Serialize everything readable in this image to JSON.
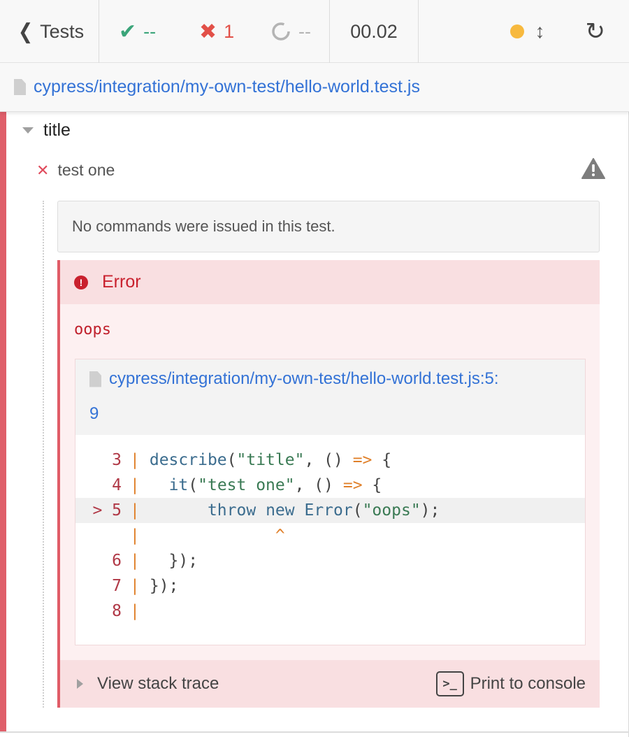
{
  "header": {
    "tests_label": "Tests",
    "passed": "--",
    "failed": "1",
    "pending": "--",
    "duration": "00.02",
    "status_dot_color": "#f7b93e"
  },
  "spec": {
    "path": "cypress/integration/my-own-test/hello-world.test.js"
  },
  "suite": {
    "title": "title"
  },
  "test": {
    "title": "test one",
    "no_commands": "No commands were issued in this test."
  },
  "error": {
    "name": "Error",
    "message": "oops",
    "file_line1": "cypress/integration/my-own-test/hello-world.test.js:5:",
    "file_line2": "9",
    "code": [
      {
        "num": "3",
        "marker": "",
        "tokens": [
          [
            "fn",
            "describe"
          ],
          [
            "p",
            "("
          ],
          [
            "str",
            "\"title\""
          ],
          [
            "p",
            ", () "
          ],
          [
            "op",
            "=>"
          ],
          [
            "p",
            " {"
          ]
        ]
      },
      {
        "num": "4",
        "marker": "",
        "tokens": [
          [
            "p",
            "  "
          ],
          [
            "fn",
            "it"
          ],
          [
            "p",
            "("
          ],
          [
            "str",
            "\"test one\""
          ],
          [
            "p",
            ", () "
          ],
          [
            "op",
            "=>"
          ],
          [
            "p",
            " {"
          ]
        ]
      },
      {
        "num": "5",
        "marker": ">",
        "hl": true,
        "tokens": [
          [
            "p",
            "      "
          ],
          [
            "kw",
            "throw"
          ],
          [
            "p",
            " "
          ],
          [
            "kw",
            "new"
          ],
          [
            "p",
            " "
          ],
          [
            "fn",
            "Error"
          ],
          [
            "p",
            "("
          ],
          [
            "str",
            "\"oops\""
          ],
          [
            "p",
            ");"
          ]
        ]
      },
      {
        "num": "",
        "marker": "",
        "tokens": [
          [
            "caret",
            "             ^"
          ]
        ]
      },
      {
        "num": "6",
        "marker": "",
        "tokens": [
          [
            "p",
            "  });"
          ]
        ]
      },
      {
        "num": "7",
        "marker": "",
        "tokens": [
          [
            "p",
            "});"
          ]
        ]
      },
      {
        "num": "8",
        "marker": "",
        "tokens": []
      }
    ],
    "view_stack_trace": "View stack trace",
    "print_to_console": "Print to console"
  },
  "colors": {
    "pass": "#3ba57a",
    "fail": "#e25048",
    "link": "#3372d6",
    "error": "#c9212e"
  }
}
